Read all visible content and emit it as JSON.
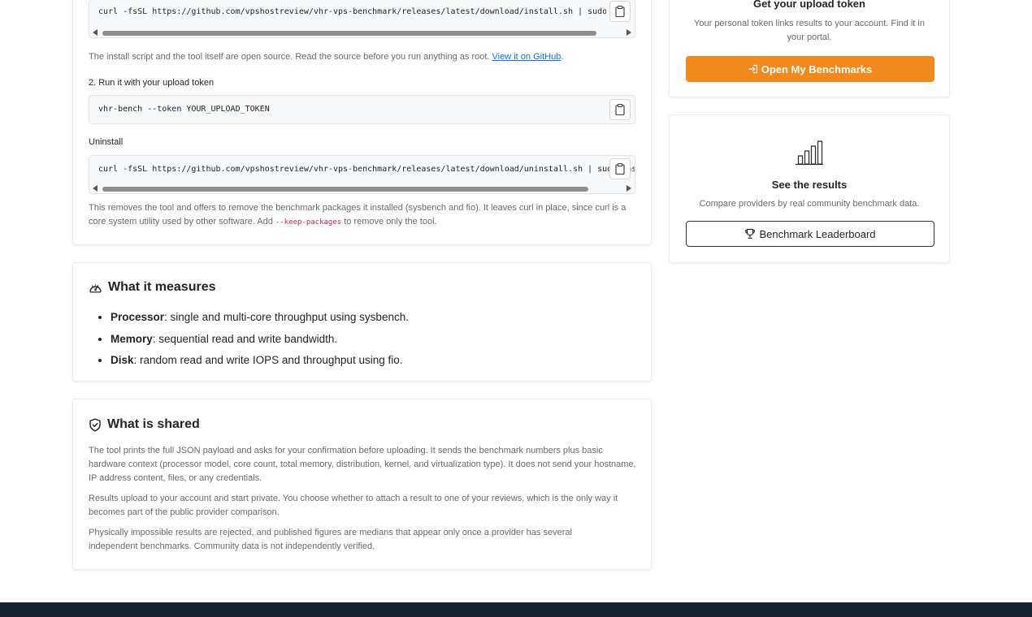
{
  "install": {
    "install_cmd": "curl -fsSL https://github.com/vpshostreview/vhr-vps-benchmark/releases/latest/download/install.sh | sudo bash",
    "note_text": "The install script and the tool itself are open source. Read the source before you run anything as root. ",
    "note_link": "View it on GitHub",
    "note_end": ".",
    "step2_label": "2. Run it with your upload token",
    "run_cmd": "vhr-bench --token YOUR_UPLOAD_TOKEN",
    "uninstall_label": "Uninstall",
    "uninstall_cmd": "curl -fsSL https://github.com/vpshostreview/vhr-vps-benchmark/releases/latest/download/uninstall.sh | sudo bash -s",
    "uninstall_note_a": "This removes the tool and offers to remove the benchmark packages it installed (sysbench and fio). It leaves curl in place, since curl is a core system utility used by other software. Add ",
    "uninstall_note_code": "--keep-packages",
    "uninstall_note_b": " to remove only the tool."
  },
  "measures": {
    "title": "What it measures",
    "items": [
      {
        "term": "Processor",
        "desc": ": single and multi-core throughput using sysbench."
      },
      {
        "term": "Memory",
        "desc": ": sequential read and write bandwidth."
      },
      {
        "term": "Disk",
        "desc": ": random read and write IOPS and throughput using fio."
      }
    ]
  },
  "shared": {
    "title": "What is shared",
    "p1": "The tool prints the full JSON payload and asks for your confirmation before uploading. It sends the benchmark numbers plus basic hardware context (processor model, core count, total memory, distribution, kernel, and virtualization type). It does not send your hostname, IP address content, files, or any credentials.",
    "p2": "Results upload to your account and start private. You choose whether to attach a result to one of your reviews, which is the only way it becomes part of the public provider comparison.",
    "p3": "Physically impossible results are rejected, and published figures are medians that appear only once a provider has several independent benchmarks. Community data is not independently verified."
  },
  "token_card": {
    "title": "Get your upload token",
    "desc": "Your personal token links results to your account. Find it in your portal.",
    "button": "Open My Benchmarks"
  },
  "results_card": {
    "title": "See the results",
    "desc": "Compare providers by real community benchmark data.",
    "button": "Benchmark Leaderboard"
  },
  "icons": {
    "copy": "clipboard-icon",
    "gauge": "speedometer-icon",
    "shield": "shield-check-icon",
    "chart": "bar-chart-icon",
    "login": "box-arrow-in-icon",
    "trophy": "trophy-icon"
  },
  "colors": {
    "accent_orange": "#f0891e",
    "link_blue": "#0d6efd",
    "footer_dark": "#16222e",
    "inline_code": "#c2255c"
  }
}
